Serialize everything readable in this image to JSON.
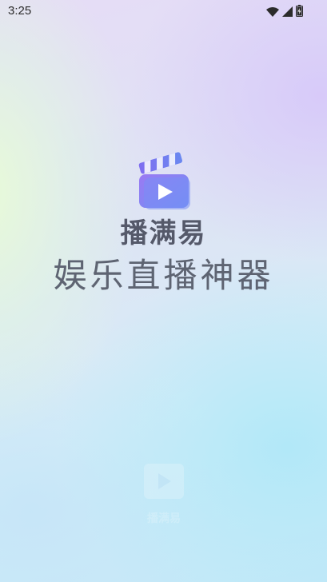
{
  "status_bar": {
    "time": "3:25",
    "icons": [
      "wifi-icon",
      "signal-icon",
      "battery-icon"
    ]
  },
  "splash": {
    "brand_name": "播满易",
    "tagline": "娱乐直播神器",
    "watermark_text": "播满易"
  },
  "colors": {
    "logo_gradient_start": "#8f72f0",
    "logo_gradient_end": "#6e8cf2",
    "text_primary": "#55596a",
    "text_secondary": "#5e6472"
  }
}
